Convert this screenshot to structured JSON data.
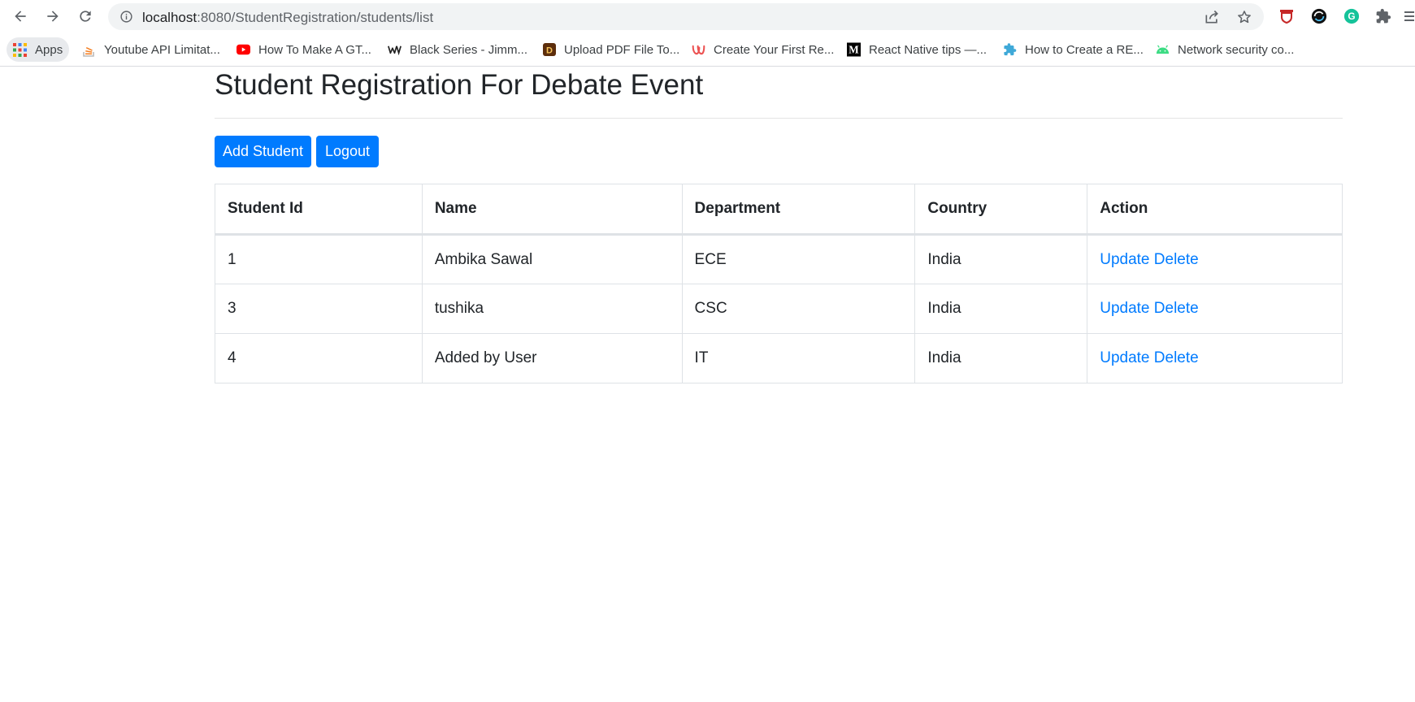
{
  "browser": {
    "url_host": "localhost",
    "url_path": ":8080/StudentRegistration/students/list",
    "bookmarks": [
      {
        "label": "Apps",
        "icon": "apps-grid-icon"
      },
      {
        "label": "Youtube API Limitat...",
        "icon": "stackoverflow-icon"
      },
      {
        "label": "How To Make A GT...",
        "icon": "youtube-icon"
      },
      {
        "label": "Black Series - Jimm...",
        "icon": "wix-icon"
      },
      {
        "label": "Upload PDF File To...",
        "icon": "d-icon"
      },
      {
        "label": "Create Your First Re...",
        "icon": "u-icon"
      },
      {
        "label": "React Native tips —...",
        "icon": "medium-icon"
      },
      {
        "label": "How to Create a RE...",
        "icon": "puzzle-icon"
      },
      {
        "label": "Network security co...",
        "icon": "android-icon"
      }
    ],
    "medium_glyph": "M"
  },
  "page": {
    "title": "Student Registration For Debate Event",
    "add_button": "Add Student",
    "logout_button": "Logout"
  },
  "table": {
    "headers": [
      "Student Id",
      "Name",
      "Department",
      "Country",
      "Action"
    ],
    "rows": [
      {
        "id": "1",
        "name": "Ambika Sawal",
        "department": "ECE",
        "country": "India",
        "update": "Update",
        "delete": "Delete"
      },
      {
        "id": "3",
        "name": "tushika",
        "department": "CSC",
        "country": "India",
        "update": "Update",
        "delete": "Delete"
      },
      {
        "id": "4",
        "name": "Added by User",
        "department": "IT",
        "country": "India",
        "update": "Update",
        "delete": "Delete"
      }
    ]
  },
  "colors": {
    "primary": "#007bff",
    "text": "#212529",
    "border": "#dee2e6"
  }
}
